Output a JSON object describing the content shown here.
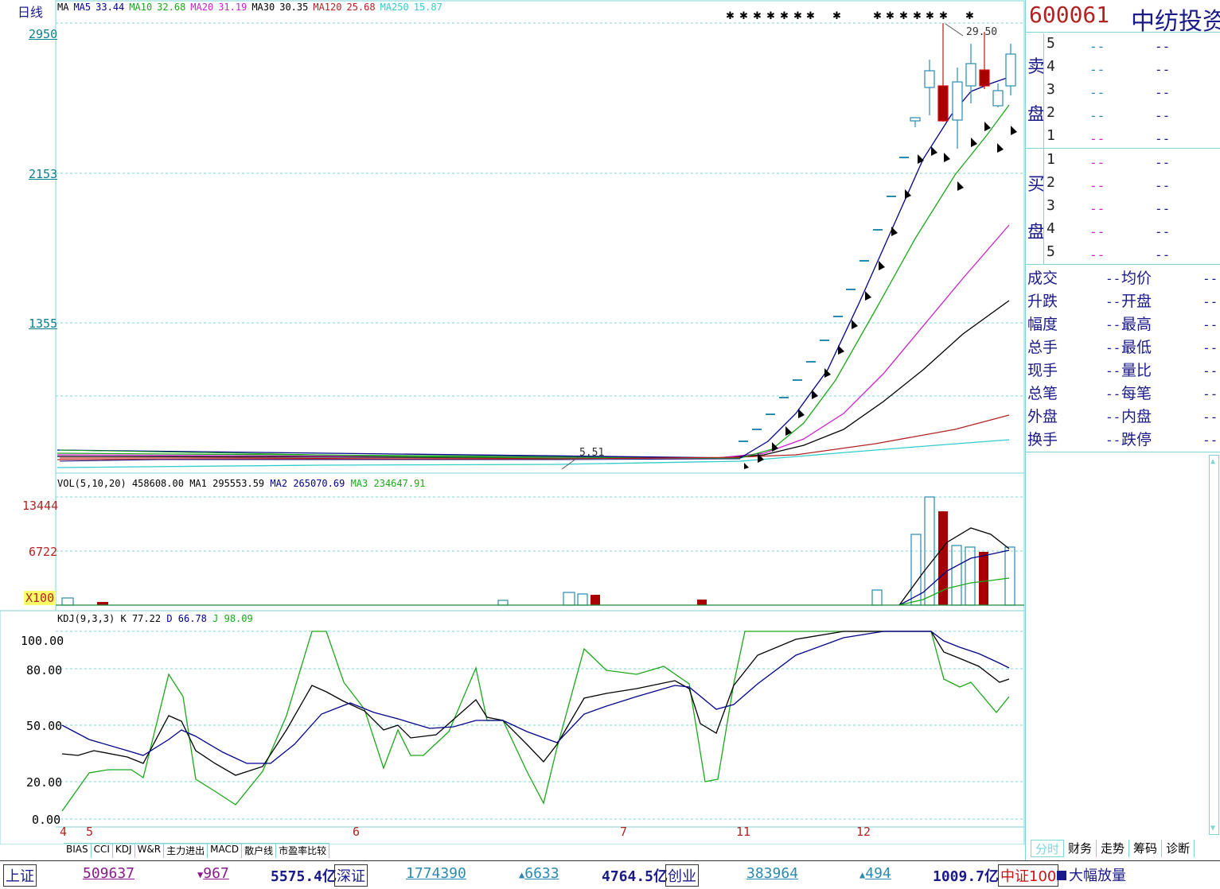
{
  "header": {
    "period": "日线",
    "ma": {
      "label": "MA",
      "items": [
        {
          "name": "MA5",
          "value": "33.44",
          "color": "#00008b"
        },
        {
          "name": "MA10",
          "value": "32.68",
          "color": "#1aa81a"
        },
        {
          "name": "MA20",
          "value": "31.19",
          "color": "#cc22cc"
        },
        {
          "name": "MA30",
          "value": "30.35",
          "color": "#000000"
        },
        {
          "name": "MA120",
          "value": "25.68",
          "color": "#b22222"
        },
        {
          "name": "MA250",
          "value": "15.87",
          "color": "#33cccc"
        }
      ]
    }
  },
  "price_axis": [
    "2950",
    "2153",
    "1355"
  ],
  "annotations": {
    "high": "29.50",
    "low": "5.51"
  },
  "volume": {
    "title": "VOL(5,10,20)",
    "value": "458608.00",
    "ma1_label": "MA1",
    "ma1": "295553.59",
    "ma2_label": "MA2",
    "ma2": "265070.69",
    "ma3_label": "MA3",
    "ma3": "234647.91",
    "axis": [
      "13444",
      "6722"
    ],
    "unit": "X100"
  },
  "kdj": {
    "title": "KDJ(9,3,3)",
    "k_label": "K",
    "k": "77.22",
    "d_label": "D",
    "d": "66.78",
    "j_label": "J",
    "j": "98.09",
    "axis": [
      "100.00",
      "80.00",
      "50.00",
      "20.00",
      "0.00"
    ]
  },
  "months": [
    "4",
    "5",
    "6",
    "7",
    "11",
    "12"
  ],
  "bottom_tabs": [
    "BIAS",
    "CCI",
    "KDJ",
    "W&R",
    "主力进出",
    "MACD",
    "散户线",
    "市盈率比较"
  ],
  "right_tabs": [
    "分时",
    "财务",
    "走势",
    "筹码",
    "诊断"
  ],
  "quote": {
    "code": "600061",
    "name": "中纺投资",
    "sell_label": [
      "卖",
      "盘"
    ],
    "buy_label": [
      "买",
      "盘"
    ],
    "sell_levels": [
      "5",
      "4",
      "3",
      "2",
      "1"
    ],
    "buy_levels": [
      "1",
      "2",
      "3",
      "4",
      "5"
    ],
    "dash": "--",
    "stats_left": [
      "成交",
      "升跌",
      "幅度",
      "总手",
      "现手",
      "总笔",
      "外盘",
      "换手"
    ],
    "stats_mid": [
      "均价",
      "开盘",
      "最高",
      "最低",
      "量比",
      "每笔",
      "内盘",
      "跌停"
    ]
  },
  "status": {
    "sh_label": "上证",
    "sh_vol": "509637",
    "sh_chg": "967",
    "sh_amt": "5575.4亿",
    "sz_label": "深证",
    "sz_vol": "1774390",
    "sz_chg": "6633",
    "sz_amt": "4764.5亿",
    "cy_label": "创业",
    "cy_vol": "383964",
    "cy_chg": "494",
    "cy_amt": "1009.7亿",
    "zz_label": "中证100",
    "big_label": "大幅放量",
    "colors": {
      "up": "#1a8a3a",
      "down": "#cc1111",
      "text": "#1a1a8a"
    }
  },
  "chart_data": [
    {
      "type": "candlestick",
      "title": "",
      "xlabel": "",
      "ylabel": "",
      "y_axis_ticks": [
        "2950",
        "2153",
        "1355"
      ],
      "note": "price moves flat near 5.51 until month 11, then rises steeply to a high of 29.50 in month 12",
      "series": [
        {
          "name": "MA5",
          "last": 33.44
        },
        {
          "name": "MA10",
          "last": 32.68
        },
        {
          "name": "MA20",
          "last": 31.19
        },
        {
          "name": "MA30",
          "last": 30.35
        },
        {
          "name": "MA120",
          "last": 25.68
        },
        {
          "name": "MA250",
          "last": 15.87
        }
      ]
    },
    {
      "type": "bar",
      "title": "VOL(5,10,20)",
      "ylim": [
        0,
        13444
      ],
      "values_tail": [
        2300,
        0,
        0,
        0,
        0,
        9000,
        13444,
        11600,
        7700,
        7500,
        6500,
        7000
      ]
    },
    {
      "type": "line",
      "title": "KDJ(9,3,3)",
      "ylim": [
        0,
        100
      ],
      "series": [
        {
          "name": "K",
          "last": 77.22
        },
        {
          "name": "D",
          "last": 66.78
        },
        {
          "name": "J",
          "last": 98.09
        }
      ]
    }
  ]
}
